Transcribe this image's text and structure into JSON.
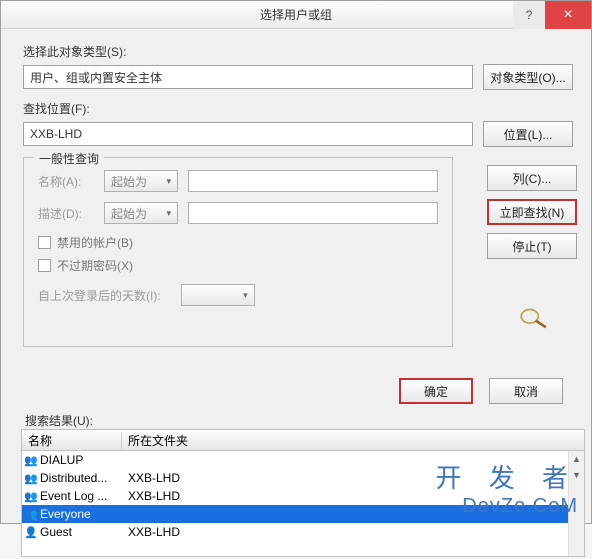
{
  "titlebar": {
    "title": "选择用户或组",
    "help": "?",
    "close": "×"
  },
  "objtype": {
    "label": "选择此对象类型(S):",
    "value": "用户、组或内置安全主体",
    "button": "对象类型(O)..."
  },
  "location": {
    "label": "查找位置(F):",
    "value": "XXB-LHD",
    "button": "位置(L)..."
  },
  "query": {
    "legend": "一般性查询",
    "name_label": "名称(A):",
    "name_select": "起始为",
    "desc_label": "描述(D):",
    "desc_select": "起始为",
    "chk_disabled": "禁用的帐户(B)",
    "chk_nopwd": "不过期密码(X)",
    "lastlogin_label": "自上次登录后的天数(I):"
  },
  "sidebuttons": {
    "columns": "列(C)...",
    "findnow": "立即查找(N)",
    "stop": "停止(T)"
  },
  "actions": {
    "ok": "确定",
    "cancel": "取消"
  },
  "results": {
    "label": "搜索结果(U):",
    "col_name": "名称",
    "col_folder": "所在文件夹",
    "rows": [
      {
        "name": "DIALUP",
        "folder": ""
      },
      {
        "name": "Distributed...",
        "folder": "XXB-LHD"
      },
      {
        "name": "Event Log ...",
        "folder": "XXB-LHD"
      },
      {
        "name": "Everyone",
        "folder": ""
      },
      {
        "name": "Guest",
        "folder": "XXB-LHD"
      }
    ]
  },
  "watermark": {
    "line1": "开 发 者",
    "line2": "DevZe.CoM"
  }
}
